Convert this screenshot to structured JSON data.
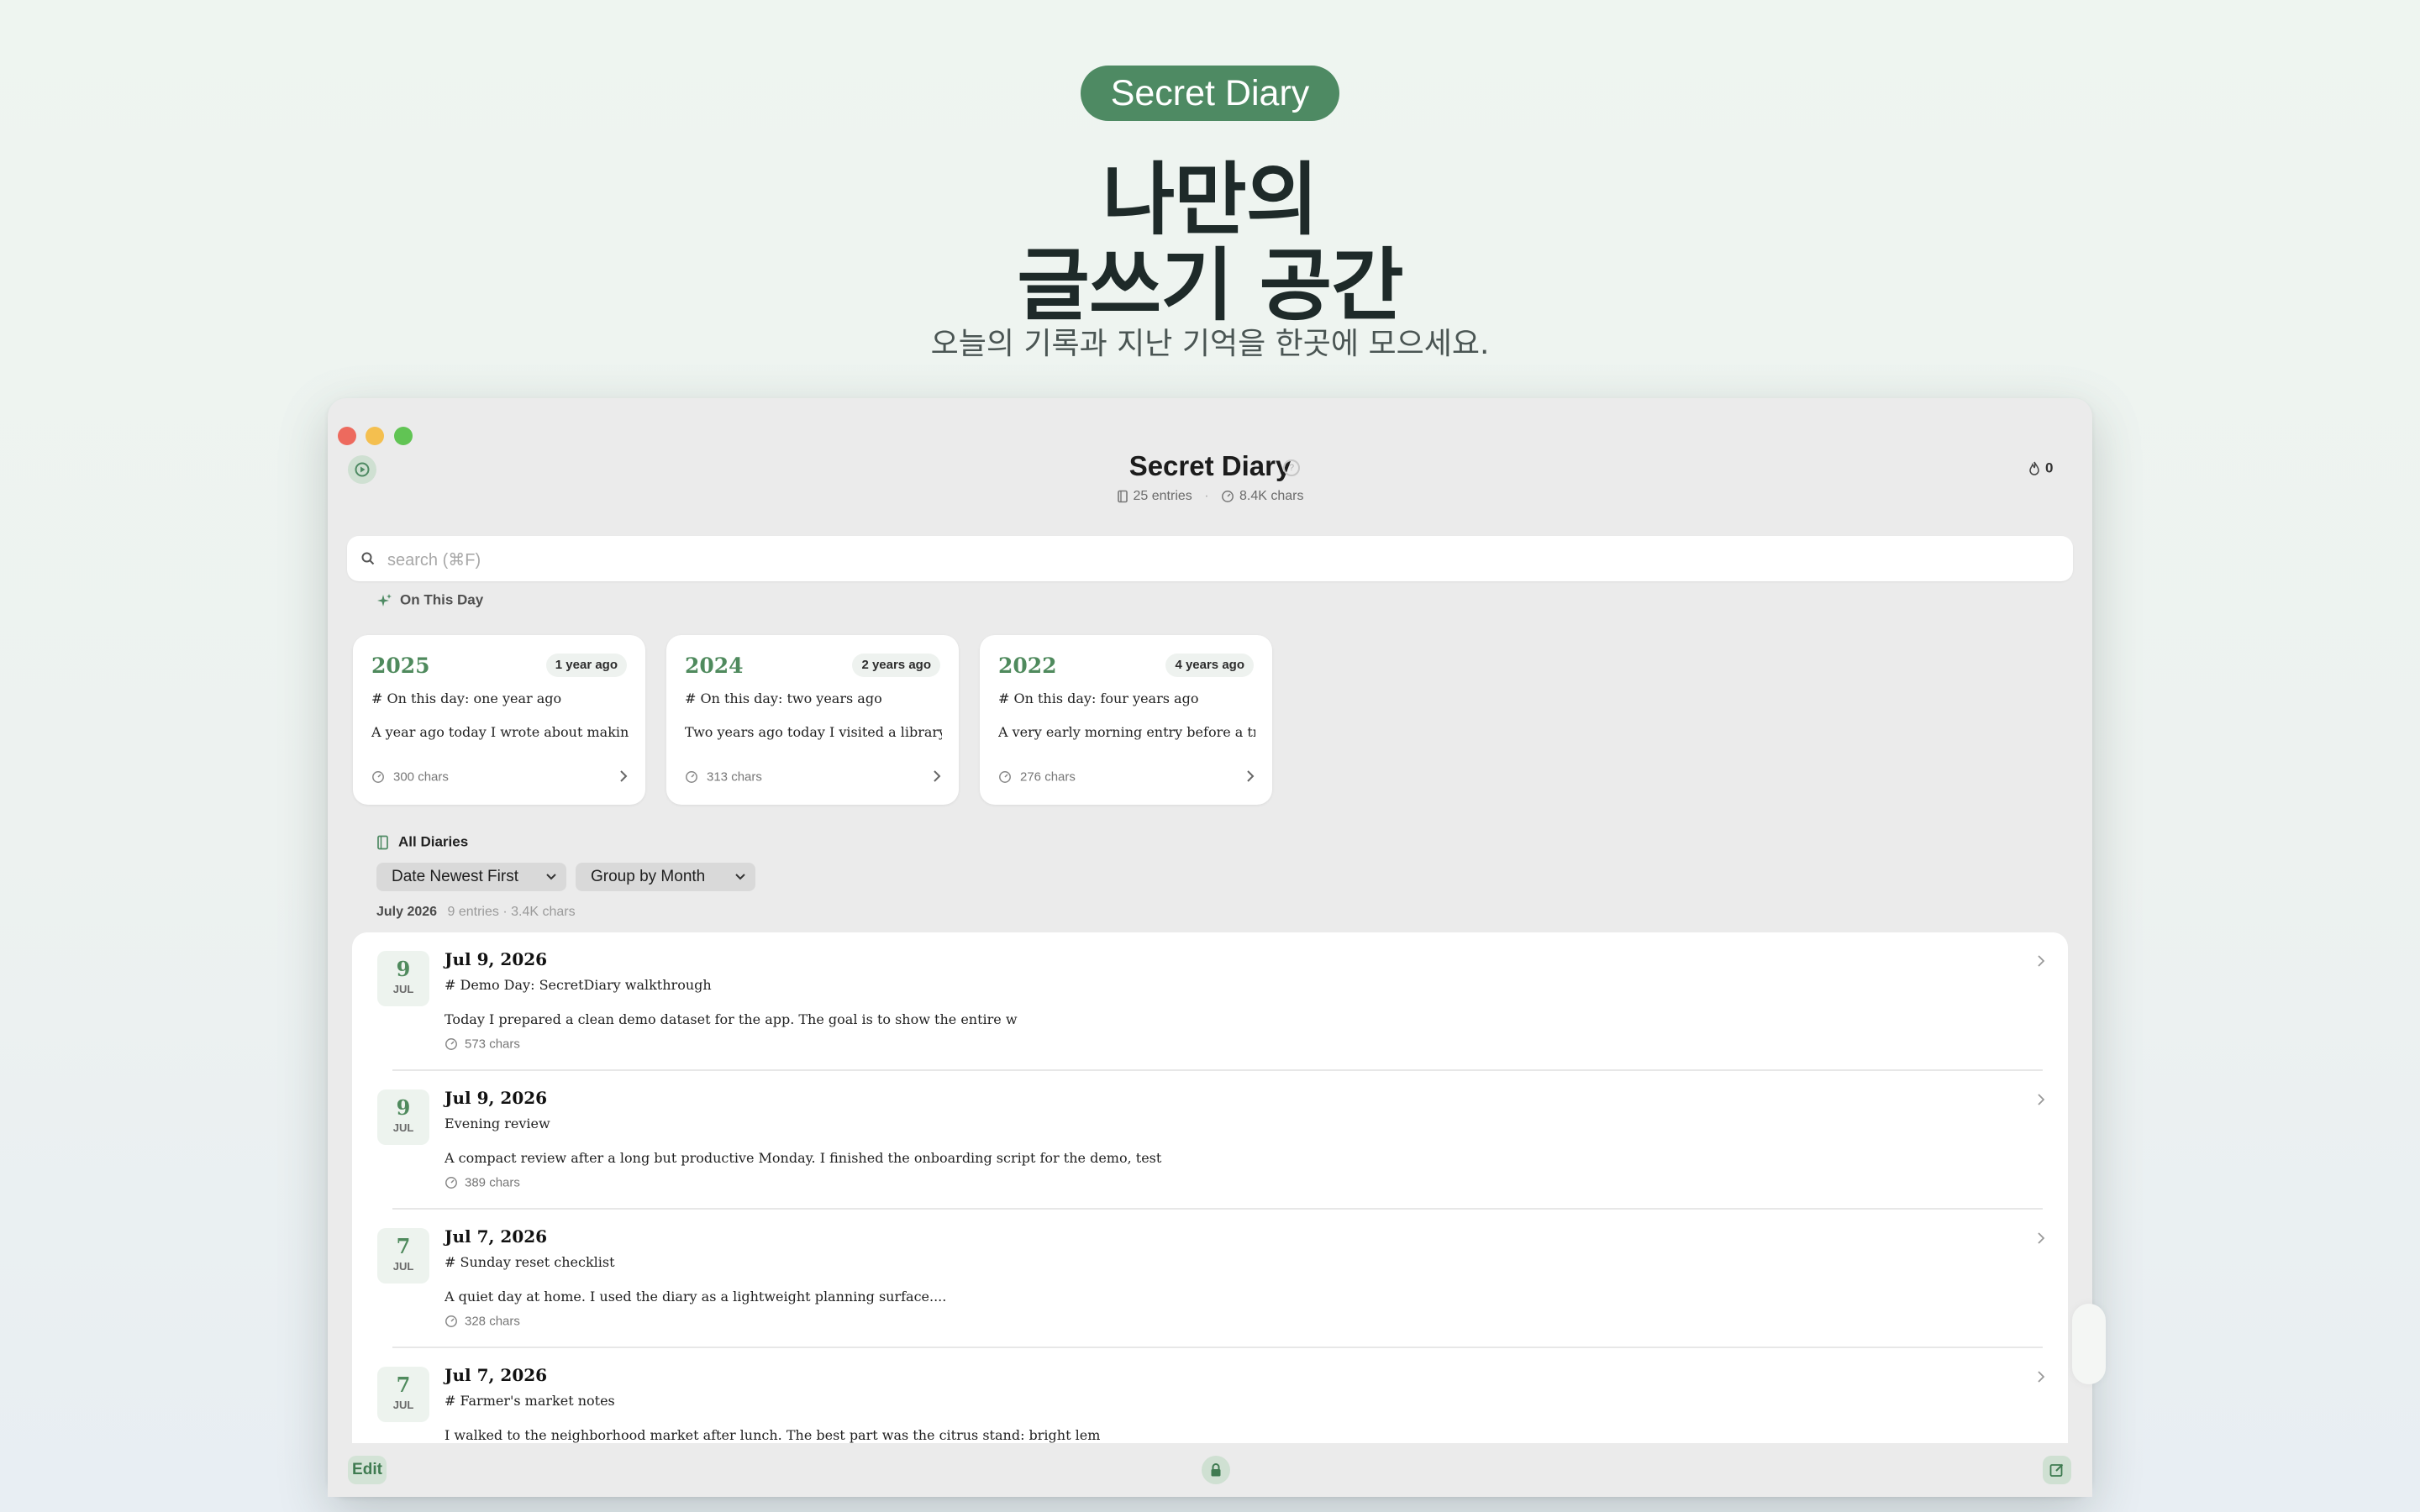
{
  "hero": {
    "pill": "Secret Diary",
    "headline_line1": "나만의",
    "headline_line2": "글쓰기 공간",
    "subline": "오늘의 기록과 지난 기억을 한곳에 모으세요."
  },
  "header": {
    "title": "Secret Diary",
    "entries": "25 entries",
    "chars": "8.4K chars",
    "flame_count": "0"
  },
  "search": {
    "placeholder": "search (⌘F)"
  },
  "on_this_day": {
    "label": "On This Day",
    "cards": [
      {
        "year": "2025",
        "ago": "1 year ago",
        "heading": "# On this day: one year ago",
        "excerpt": "A year ago today I wrote about makin...",
        "chars": "300 chars"
      },
      {
        "year": "2024",
        "ago": "2 years ago",
        "heading": "# On this day: two years ago",
        "excerpt": "Two years ago today I visited a library...",
        "chars": "313 chars"
      },
      {
        "year": "2022",
        "ago": "4 years ago",
        "heading": "# On this day: four years ago",
        "excerpt": "A very early morning entry before a tr...",
        "chars": "276 chars"
      }
    ]
  },
  "all_diaries": {
    "label": "All Diaries",
    "sort": "Date Newest First",
    "group": "Group by Month",
    "month": "July 2026",
    "month_meta": "9 entries · 3.4K chars",
    "entries": [
      {
        "day": "9",
        "mon": "JUL",
        "date": "Jul 9, 2026",
        "title": "# Demo Day: SecretDiary walkthrough",
        "excerpt": "Today I prepared a clean demo dataset for the app. The goal is to show the entire w",
        "chars": "573 chars"
      },
      {
        "day": "9",
        "mon": "JUL",
        "date": "Jul 9, 2026",
        "title": "Evening review",
        "excerpt": "A compact review after a long but productive Monday. I finished the onboarding script for the demo, test",
        "chars": "389 chars"
      },
      {
        "day": "7",
        "mon": "JUL",
        "date": "Jul 7, 2026",
        "title": "# Sunday reset checklist",
        "excerpt": "A quiet day at home. I used the diary as a lightweight planning surface....",
        "chars": "328 chars"
      },
      {
        "day": "7",
        "mon": "JUL",
        "date": "Jul 7, 2026",
        "title": "# Farmer's market notes",
        "excerpt": "I walked to the neighborhood market after lunch. The best part was the citrus stand: bright lem",
        "chars": ""
      }
    ]
  },
  "footer": {
    "edit": "Edit"
  },
  "colors": {
    "accent": "#4e8a63",
    "accent_text": "#4f8a5d",
    "window_bg": "#ebebeb"
  },
  "icons": [
    "replay-icon",
    "info-icon",
    "flame-icon",
    "book-icon",
    "gauge-icon",
    "search-icon",
    "sparkle-icon",
    "chevron-right-icon",
    "chevron-down-icon",
    "lock-icon",
    "compose-icon"
  ]
}
